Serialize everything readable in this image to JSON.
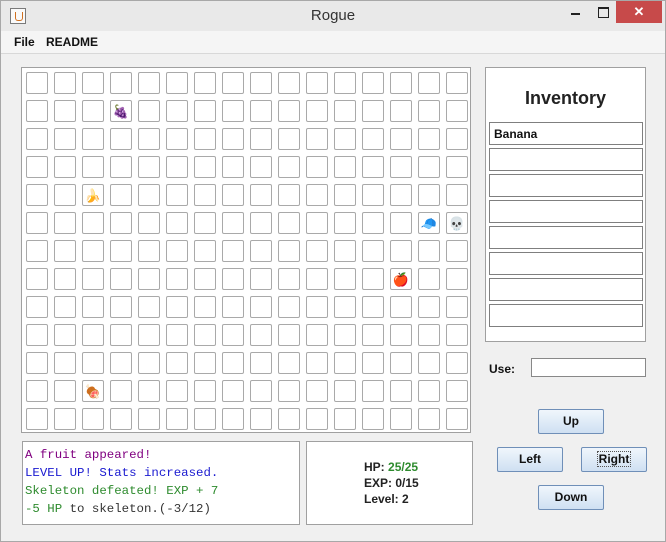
{
  "window": {
    "title": "Rogue",
    "close_glyph": "✕"
  },
  "menu": {
    "items": [
      {
        "label": "File"
      },
      {
        "label": "README"
      }
    ]
  },
  "board": {
    "columns": 16,
    "rows": 13,
    "items": [
      {
        "row": 1,
        "col": 3,
        "kind": "grapes-icon",
        "glyph": "🍇"
      },
      {
        "row": 4,
        "col": 2,
        "kind": "banana-icon",
        "glyph": "🍌"
      },
      {
        "row": 5,
        "col": 14,
        "kind": "player-icon",
        "glyph": "🧢"
      },
      {
        "row": 5,
        "col": 15,
        "kind": "skeleton-icon",
        "glyph": "💀"
      },
      {
        "row": 7,
        "col": 13,
        "kind": "apple-icon",
        "glyph": "🍎"
      },
      {
        "row": 11,
        "col": 2,
        "kind": "meat-icon",
        "glyph": "🍖"
      }
    ]
  },
  "inventory": {
    "title": "Inventory",
    "slots": [
      "Banana",
      "",
      "",
      "",
      "",
      "",
      "",
      ""
    ]
  },
  "use": {
    "label": "Use:",
    "value": ""
  },
  "controls": {
    "up": "Up",
    "left": "Left",
    "right": "Right",
    "down": "Down"
  },
  "log": {
    "lines": [
      {
        "text": "A fruit appeared!",
        "color": "#800080"
      },
      {
        "text": "LEVEL UP! Stats increased.",
        "color": "#1a1ad0"
      },
      {
        "text": "Skeleton defeated! EXP + 7",
        "color": "#2e8b2e"
      },
      {
        "text": "-5 HP to skeleton.(-3/12)",
        "color": "#333333",
        "prefix_color": "#2e8b2e"
      }
    ]
  },
  "stats": {
    "hp_label": "HP:",
    "hp_value": "25/25",
    "exp_label": "EXP:",
    "exp_value": "0/15",
    "level_label": "Level:",
    "level_value": "2"
  }
}
